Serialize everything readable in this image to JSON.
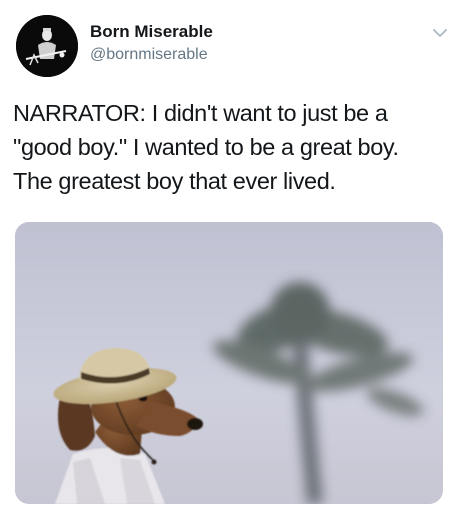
{
  "tweet": {
    "display_name": "Born Miserable",
    "handle": "@bornmiserable",
    "text_lines": [
      "NARRATOR: I didn't want to just be a",
      "\"good boy.\"  I wanted to be a great boy.",
      "The greatest boy that ever lived."
    ],
    "menu_icon": "chevron-down-icon",
    "avatar_icon": "profile-avatar",
    "media": "photo of a dachshund wearing a straw hat with a blurred palm tree"
  }
}
